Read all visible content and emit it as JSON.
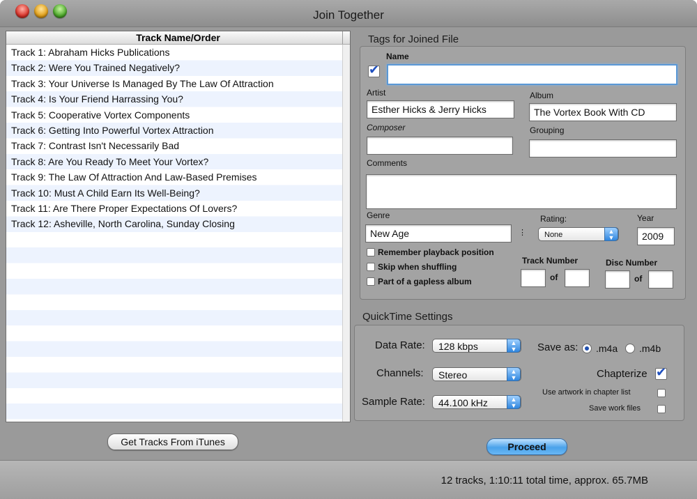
{
  "window": {
    "title": "Join Together"
  },
  "tracklist": {
    "header": "Track Name/Order",
    "tracks": [
      "Track 1: Abraham Hicks Publications",
      "Track 2: Were You Trained Negatively?",
      "Track 3: Your Universe Is Managed By The Law Of Attraction",
      "Track 4: Is Your Friend Harrassing You?",
      "Track 5: Cooperative Vortex Components",
      "Track 6: Getting Into Powerful Vortex Attraction",
      "Track 7: Contrast Isn't Necessarily Bad",
      "Track 8: Are You Ready To Meet Your Vortex?",
      "Track 9: The Law Of Attraction And Law-Based Premises",
      "Track 10: Must A Child Earn Its Well-Being?",
      "Track 11: Are There Proper Expectations Of Lovers?",
      "Track 12: Asheville, North Carolina, Sunday Closing"
    ]
  },
  "buttons": {
    "get_tracks": "Get Tracks From iTunes",
    "proceed": "Proceed"
  },
  "status": {
    "text": "12 tracks, 1:10:11 total time, approx. 65.7MB"
  },
  "tags": {
    "title": "Tags for Joined File",
    "name_label": "Name",
    "name_value": "",
    "artist_label": "Artist",
    "artist_value": "Esther Hicks & Jerry Hicks",
    "album_label": "Album",
    "album_value": "The Vortex Book With CD",
    "composer_label": "Composer",
    "composer_value": "",
    "grouping_label": "Grouping",
    "grouping_value": "",
    "comments_label": "Comments",
    "comments_value": "",
    "genre_label": "Genre",
    "genre_value": "New Age",
    "rating_label": "Rating:",
    "rating_value": "None",
    "year_label": "Year",
    "year_value": "2009",
    "remember_label": "Remember playback position",
    "skip_label": "Skip when shuffling",
    "gapless_label": "Part of a gapless album",
    "track_number_label": "Track Number",
    "disc_number_label": "Disc Number",
    "of_label": "of"
  },
  "quicktime": {
    "title": "QuickTime Settings",
    "data_rate_label": "Data Rate:",
    "data_rate_value": "128 kbps",
    "channels_label": "Channels:",
    "channels_value": "Stereo",
    "sample_rate_label": "Sample Rate:",
    "sample_rate_value": "44.100 kHz",
    "save_as_label": "Save as:",
    "m4a_label": ".m4a",
    "m4b_label": ".m4b",
    "chapterize_label": "Chapterize",
    "artwork_label": "Use artwork in chapter list",
    "save_work_label": "Save work files"
  }
}
